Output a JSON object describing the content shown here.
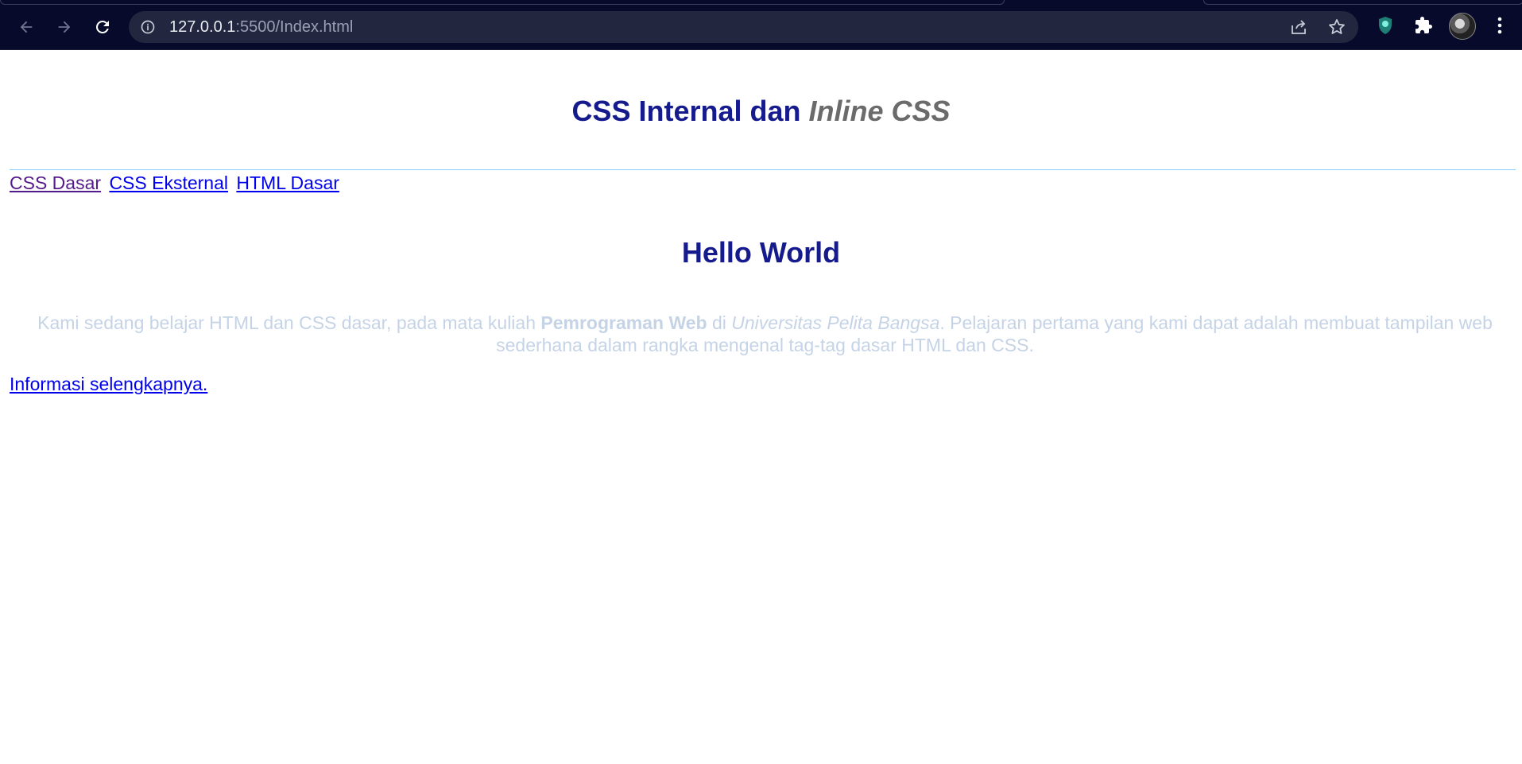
{
  "browser": {
    "url_host": "127.0.0.1",
    "url_rest": ":5500/Index.html",
    "icons": [
      "back-arrow-icon",
      "forward-arrow-icon",
      "reload-icon",
      "info-icon",
      "share-icon",
      "star-icon",
      "extension-shield-icon",
      "puzzle-icon",
      "profile-avatar",
      "menu-dots-icon"
    ]
  },
  "page": {
    "title_main": "CSS Internal dan ",
    "title_inline": "Inline",
    "title_css": " CSS",
    "nav_links": [
      "CSS Dasar",
      "CSS Eksternal",
      "HTML Dasar"
    ],
    "heading": "Hello World",
    "desc_part1": "Kami sedang belajar HTML dan CSS dasar, pada mata kuliah ",
    "desc_bold": "Pemrograman Web",
    "desc_part2": " di ",
    "desc_italic": "Universitas Pelita Bangsa",
    "desc_part3": ". Pelajaran pertama yang kami dapat adalah membuat tampilan web sederhana dalam rangka mengenal tag-tag dasar HTML dan CSS.",
    "more_link": "Informasi selengkapnya."
  },
  "colors": {
    "chrome_bg": "#070a2a",
    "omnibox_bg": "#23263f",
    "heading": "#151a8c",
    "italic_grey": "#6b6b6b",
    "rule": "#87cefa",
    "desc_text": "#c5d3e6",
    "link": "#0000ee",
    "link_visited": "#551a8b"
  }
}
